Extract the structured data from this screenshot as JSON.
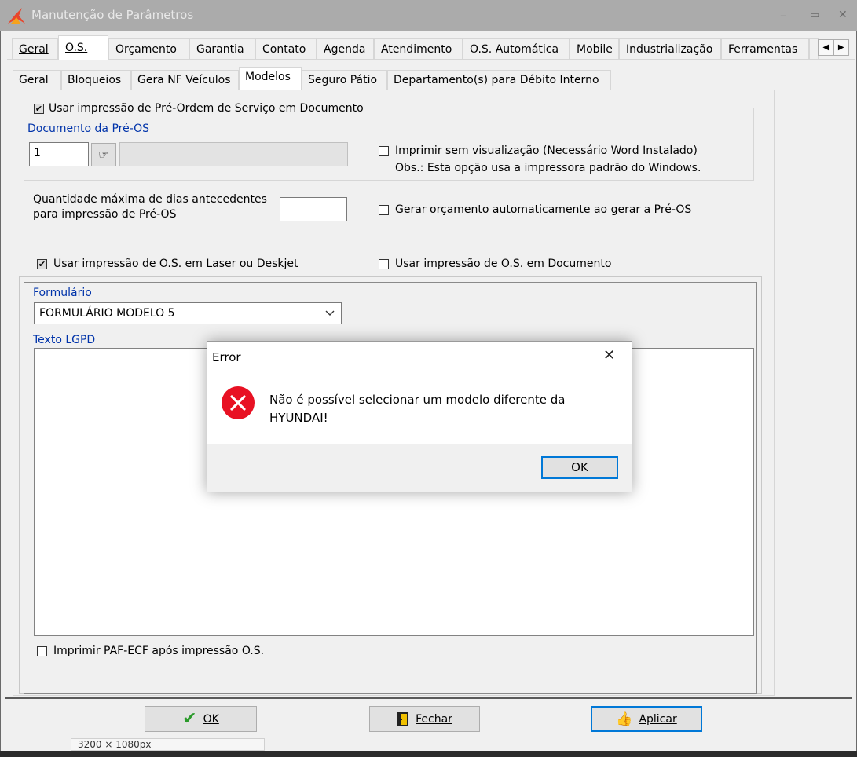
{
  "window": {
    "title": "Manutenção de Parâmetros",
    "minimize_label": "–",
    "maximize_label": "▭",
    "close_label": "✕"
  },
  "main_tabs": [
    {
      "label": "Geral"
    },
    {
      "label": "O.S."
    },
    {
      "label": "Orçamento"
    },
    {
      "label": "Garantia"
    },
    {
      "label": "Contato"
    },
    {
      "label": "Agenda"
    },
    {
      "label": "Atendimento"
    },
    {
      "label": "O.S. Automática"
    },
    {
      "label": "Mobile"
    },
    {
      "label": "Industrialização"
    },
    {
      "label": "Ferramentas"
    }
  ],
  "tab_scroll": {
    "left": "◀",
    "right": "▶"
  },
  "sub_tabs": [
    {
      "label": "Geral"
    },
    {
      "label": "Bloqueios"
    },
    {
      "label": "Gera NF Veículos"
    },
    {
      "label": "Modelos"
    },
    {
      "label": "Seguro Pátio"
    },
    {
      "label": "Departamento(s) para Débito Interno"
    }
  ],
  "pre_os": {
    "checkbox_label": "Usar impressão de Pré-Ordem de Serviço em Documento",
    "checked": true,
    "document_label": "Documento da Pré-OS",
    "document_value": "1",
    "print_no_preview_label": "Imprimir sem visualização (Necessário Word Instalado)",
    "obs_text": "Obs.: Esta opção usa a impressora padrão do Windows."
  },
  "max_days": {
    "label_line1": "Quantidade máxima de dias antecedentes",
    "label_line2": "para impressão de Pré-OS",
    "value": ""
  },
  "gerar_orcamento_label": "Gerar orçamento automaticamente ao gerar a Pré-OS",
  "laser": {
    "label": "Usar impressão de O.S. em Laser ou Deskjet",
    "checked": true
  },
  "os_documento_label": "Usar impressão de O.S. em Documento",
  "formulario": {
    "label": "Formulário",
    "selected": "FORMULÁRIO MODELO 5"
  },
  "texto_lgpd_label": "Texto LGPD",
  "paf_ecf_label": "Imprimir PAF-ECF após impressão O.S.",
  "buttons": {
    "ok": "OK",
    "fechar": "Fechar",
    "aplicar": "Aplicar"
  },
  "dialog": {
    "title": "Error",
    "close": "✕",
    "message_line1": "Não é possível selecionar um modelo diferente da",
    "message_line2": "HYUNDAI!",
    "ok": "OK"
  },
  "background_partial_text": "3200 × 1080px"
}
